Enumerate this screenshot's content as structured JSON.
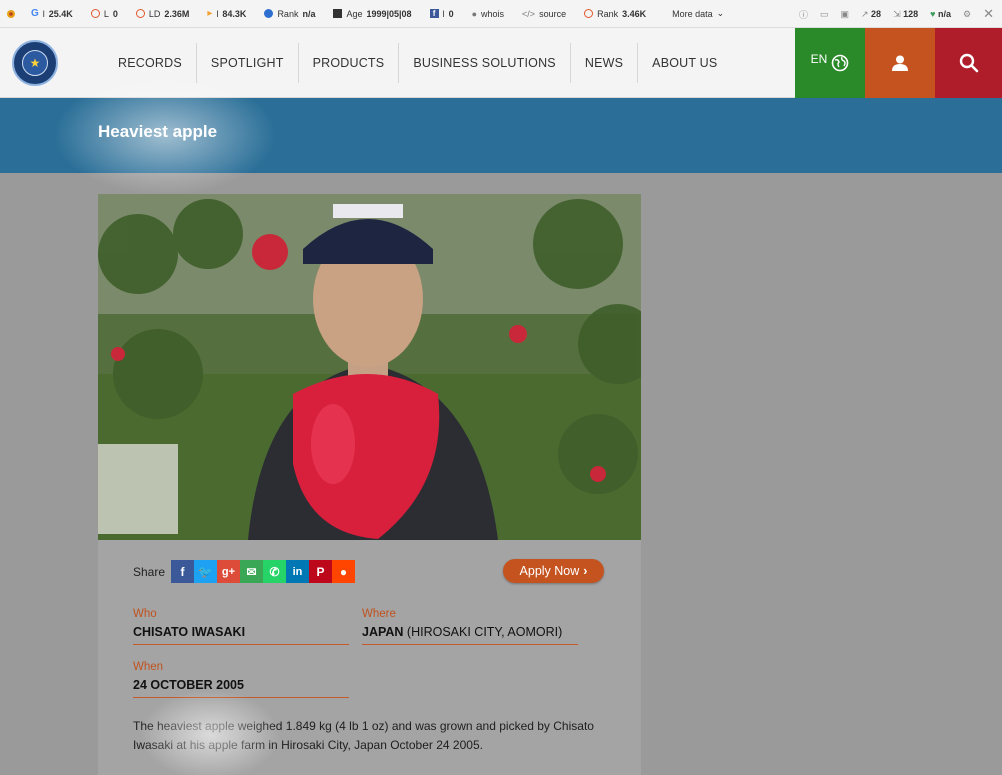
{
  "seo_toolbar": {
    "items": [
      {
        "icon": "google-icon",
        "text": "l",
        "value": "25.4K"
      },
      {
        "icon": "links-icon",
        "text": "L",
        "value": "0"
      },
      {
        "icon": "ld-icon",
        "text": "LD",
        "value": "2.36M"
      },
      {
        "icon": "bing-icon",
        "text": "l",
        "value": "84.3K"
      },
      {
        "icon": "rank-icon",
        "text": "Rank",
        "value": "n/a"
      },
      {
        "icon": "calendar-icon",
        "text": "Age",
        "value": "1999|05|08"
      },
      {
        "icon": "facebook-icon",
        "text": "l",
        "value": "0"
      },
      {
        "icon": "person-icon",
        "text": "whois",
        "value": ""
      },
      {
        "icon": "code-icon",
        "text": "source",
        "value": ""
      },
      {
        "icon": "rank2-icon",
        "text": "Rank",
        "value": "3.46K"
      }
    ],
    "more_data": "More data",
    "right": {
      "links_out": "28",
      "links_in": "128",
      "trust": "n/a"
    }
  },
  "header": {
    "logo_alt": "GUINNESS WORLD RECORDS",
    "nav": [
      "RECORDS",
      "SPOTLIGHT",
      "PRODUCTS",
      "BUSINESS SOLUTIONS",
      "NEWS",
      "ABOUT US"
    ],
    "language": "EN"
  },
  "page": {
    "title": "Heaviest apple"
  },
  "record": {
    "share_label": "Share",
    "apply_label": "Apply Now",
    "who_label": "Who",
    "who_value": "CHISATO IWASAKI",
    "where_label": "Where",
    "where_value_bold": "JAPAN",
    "where_value_rest": " (HIROSAKI CITY, AOMORI)",
    "when_label": "When",
    "when_value": "24 OCTOBER 2005",
    "description": "The heaviest apple weighed 1.849 kg (4 lb 1 oz) and was grown and picked by Chisato Iwasaki at his apple farm in Hirosaki City, Japan October 24 2005."
  },
  "colors": {
    "banner": "#2b6f98",
    "lang_btn": "#2a8a2a",
    "user_btn": "#c4531f",
    "search_btn": "#b01d2a",
    "accent": "#c0521f"
  }
}
